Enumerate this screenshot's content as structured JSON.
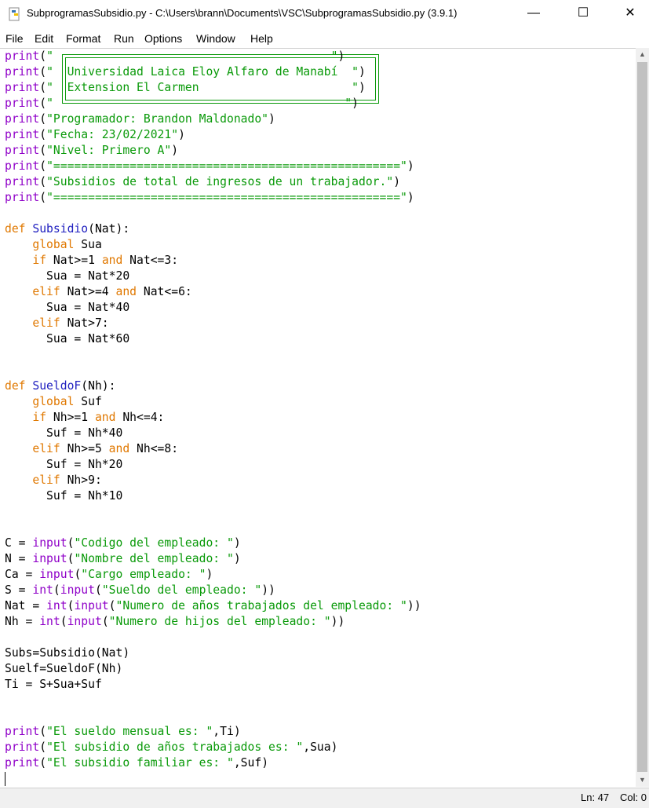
{
  "window": {
    "title": "SubprogramasSubsidio.py - C:\\Users\\brann\\Documents\\VSC\\SubprogramasSubsidio.py (3.9.1)",
    "minimize": "—",
    "maximize": "☐",
    "close": "✕"
  },
  "menu": [
    "File",
    "Edit",
    "Format",
    "Run",
    "Options",
    "Window",
    "Help"
  ],
  "code": [
    [
      [
        "bi",
        "print"
      ],
      [
        "t",
        "("
      ],
      [
        "str",
        "\"                                        \""
      ],
      [
        "t",
        ")"
      ]
    ],
    [
      [
        "bi",
        "print"
      ],
      [
        "t",
        "("
      ],
      [
        "str",
        "\"  Universidad Laica Eloy Alfaro de Manabí  \""
      ],
      [
        "t",
        ")"
      ]
    ],
    [
      [
        "bi",
        "print"
      ],
      [
        "t",
        "("
      ],
      [
        "str",
        "\"  Extension El Carmen                      \""
      ],
      [
        "t",
        ")"
      ]
    ],
    [
      [
        "bi",
        "print"
      ],
      [
        "t",
        "("
      ],
      [
        "str",
        "\"                                          \""
      ],
      [
        "t",
        ")"
      ]
    ],
    [
      [
        "bi",
        "print"
      ],
      [
        "t",
        "("
      ],
      [
        "str",
        "\"Programador: Brandon Maldonado\""
      ],
      [
        "t",
        ")"
      ]
    ],
    [
      [
        "bi",
        "print"
      ],
      [
        "t",
        "("
      ],
      [
        "str",
        "\"Fecha: 23/02/2021\""
      ],
      [
        "t",
        ")"
      ]
    ],
    [
      [
        "bi",
        "print"
      ],
      [
        "t",
        "("
      ],
      [
        "str",
        "\"Nivel: Primero A\""
      ],
      [
        "t",
        ")"
      ]
    ],
    [
      [
        "bi",
        "print"
      ],
      [
        "t",
        "("
      ],
      [
        "str",
        "\"==================================================\""
      ],
      [
        "t",
        ")"
      ]
    ],
    [
      [
        "bi",
        "print"
      ],
      [
        "t",
        "("
      ],
      [
        "str",
        "\"Subsidios de total de ingresos de un trabajador.\""
      ],
      [
        "t",
        ")"
      ]
    ],
    [
      [
        "bi",
        "print"
      ],
      [
        "t",
        "("
      ],
      [
        "str",
        "\"==================================================\""
      ],
      [
        "t",
        ")"
      ]
    ],
    [],
    [
      [
        "kw",
        "def"
      ],
      [
        "t",
        " "
      ],
      [
        "def",
        "Subsidio"
      ],
      [
        "t",
        "(Nat):"
      ]
    ],
    [
      [
        "t",
        "    "
      ],
      [
        "kw",
        "global"
      ],
      [
        "t",
        " Sua"
      ]
    ],
    [
      [
        "t",
        "    "
      ],
      [
        "kw",
        "if"
      ],
      [
        "t",
        " Nat>=1 "
      ],
      [
        "kw",
        "and"
      ],
      [
        "t",
        " Nat<=3:"
      ]
    ],
    [
      [
        "t",
        "      Sua = Nat*20"
      ]
    ],
    [
      [
        "t",
        "    "
      ],
      [
        "kw",
        "elif"
      ],
      [
        "t",
        " Nat>=4 "
      ],
      [
        "kw",
        "and"
      ],
      [
        "t",
        " Nat<=6:"
      ]
    ],
    [
      [
        "t",
        "      Sua = Nat*40"
      ]
    ],
    [
      [
        "t",
        "    "
      ],
      [
        "kw",
        "elif"
      ],
      [
        "t",
        " Nat>7:"
      ]
    ],
    [
      [
        "t",
        "      Sua = Nat*60"
      ]
    ],
    [],
    [],
    [
      [
        "kw",
        "def"
      ],
      [
        "t",
        " "
      ],
      [
        "def",
        "SueldoF"
      ],
      [
        "t",
        "(Nh):"
      ]
    ],
    [
      [
        "t",
        "    "
      ],
      [
        "kw",
        "global"
      ],
      [
        "t",
        " Suf"
      ]
    ],
    [
      [
        "t",
        "    "
      ],
      [
        "kw",
        "if"
      ],
      [
        "t",
        " Nh>=1 "
      ],
      [
        "kw",
        "and"
      ],
      [
        "t",
        " Nh<=4:"
      ]
    ],
    [
      [
        "t",
        "      Suf = Nh*40"
      ]
    ],
    [
      [
        "t",
        "    "
      ],
      [
        "kw",
        "elif"
      ],
      [
        "t",
        " Nh>=5 "
      ],
      [
        "kw",
        "and"
      ],
      [
        "t",
        " Nh<=8:"
      ]
    ],
    [
      [
        "t",
        "      Suf = Nh*20"
      ]
    ],
    [
      [
        "t",
        "    "
      ],
      [
        "kw",
        "elif"
      ],
      [
        "t",
        " Nh>9:"
      ]
    ],
    [
      [
        "t",
        "      Suf = Nh*10"
      ]
    ],
    [],
    [],
    [
      [
        "t",
        "C = "
      ],
      [
        "bi",
        "input"
      ],
      [
        "t",
        "("
      ],
      [
        "str",
        "\"Codigo del empleado: \""
      ],
      [
        "t",
        ")"
      ]
    ],
    [
      [
        "t",
        "N = "
      ],
      [
        "bi",
        "input"
      ],
      [
        "t",
        "("
      ],
      [
        "str",
        "\"Nombre del empleado: \""
      ],
      [
        "t",
        ")"
      ]
    ],
    [
      [
        "t",
        "Ca = "
      ],
      [
        "bi",
        "input"
      ],
      [
        "t",
        "("
      ],
      [
        "str",
        "\"Cargo empleado: \""
      ],
      [
        "t",
        ")"
      ]
    ],
    [
      [
        "t",
        "S = "
      ],
      [
        "bi",
        "int"
      ],
      [
        "t",
        "("
      ],
      [
        "bi",
        "input"
      ],
      [
        "t",
        "("
      ],
      [
        "str",
        "\"Sueldo del empleado: \""
      ],
      [
        "t",
        "))"
      ]
    ],
    [
      [
        "t",
        "Nat = "
      ],
      [
        "bi",
        "int"
      ],
      [
        "t",
        "("
      ],
      [
        "bi",
        "input"
      ],
      [
        "t",
        "("
      ],
      [
        "str",
        "\"Numero de años trabajados del empleado: \""
      ],
      [
        "t",
        "))"
      ]
    ],
    [
      [
        "t",
        "Nh = "
      ],
      [
        "bi",
        "int"
      ],
      [
        "t",
        "("
      ],
      [
        "bi",
        "input"
      ],
      [
        "t",
        "("
      ],
      [
        "str",
        "\"Numero de hijos del empleado: \""
      ],
      [
        "t",
        "))"
      ]
    ],
    [],
    [
      [
        "t",
        "Subs=Subsidio(Nat)"
      ]
    ],
    [
      [
        "t",
        "Suelf=SueldoF(Nh)"
      ]
    ],
    [
      [
        "t",
        "Ti = S+Sua+Suf"
      ]
    ],
    [],
    [],
    [
      [
        "bi",
        "print"
      ],
      [
        "t",
        "("
      ],
      [
        "str",
        "\"El sueldo mensual es: \""
      ],
      [
        "t",
        ",Ti)"
      ]
    ],
    [
      [
        "bi",
        "print"
      ],
      [
        "t",
        "("
      ],
      [
        "str",
        "\"El subsidio de años trabajados es: \""
      ],
      [
        "t",
        ",Sua)"
      ]
    ],
    [
      [
        "bi",
        "print"
      ],
      [
        "t",
        "("
      ],
      [
        "str",
        "\"El subsidio familiar es: \""
      ],
      [
        "t",
        ",Suf)"
      ]
    ],
    []
  ],
  "status": {
    "line": "Ln: 47",
    "col": "Col: 0"
  },
  "colors": {
    "keyword": "#e07800",
    "builtin": "#8f00c8",
    "string": "#0a9a0a",
    "definition": "#2020c0"
  }
}
